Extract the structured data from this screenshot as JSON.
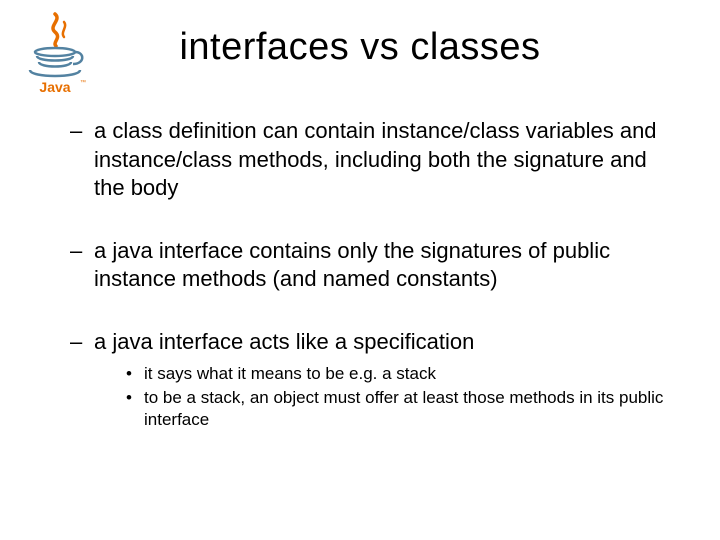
{
  "logo_alt": "Java logo",
  "title": "interfaces vs classes",
  "bullets": [
    {
      "text": "a class definition can contain instance/class variables and instance/class methods, including both the signature and the body",
      "sub": []
    },
    {
      "text": "a java interface contains only the signatures of public instance methods (and named constants)",
      "sub": []
    },
    {
      "text": "a java interface acts like a specification",
      "sub": [
        "it says what it means to be e.g. a stack",
        "to be a stack, an object must offer at least those methods in its public interface"
      ]
    }
  ]
}
